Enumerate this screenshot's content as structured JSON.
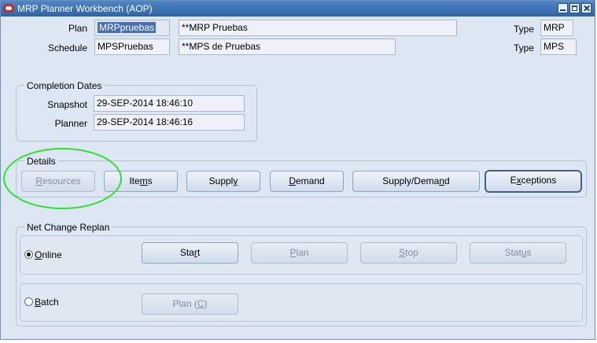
{
  "window": {
    "title": "MRP Planner Workbench (AOP)"
  },
  "header": {
    "plan_label": "Plan",
    "plan_value": "MRPpruebas",
    "plan_desc": "**MRP Pruebas",
    "plan_type_label": "Type",
    "plan_type_value": "MRP",
    "schedule_label": "Schedule",
    "schedule_value": "MPSPruebas",
    "schedule_desc": "**MPS de Pruebas",
    "schedule_type_label": "Type",
    "schedule_type_value": "MPS"
  },
  "completion": {
    "title": "Completion Dates",
    "snapshot_label": "Snapshot",
    "snapshot_value": "29-SEP-2014 18:46:10",
    "planner_label": "Planner",
    "planner_value": "29-SEP-2014 18:46:16"
  },
  "details": {
    "title": "Details",
    "resources": {
      "pre": "",
      "ul": "R",
      "post": "esources"
    },
    "items": {
      "pre": "Ite",
      "ul": "m",
      "post": "s"
    },
    "supply": {
      "pre": "Suppl",
      "ul": "y",
      "post": ""
    },
    "demand": {
      "pre": "",
      "ul": "D",
      "post": "emand"
    },
    "supply_demand": {
      "pre": "Supply/Dema",
      "ul": "n",
      "post": "d"
    },
    "exceptions": {
      "pre": "E",
      "ul": "x",
      "post": "ceptions"
    }
  },
  "replan": {
    "title": "Net Change Replan",
    "online": {
      "pre": "",
      "ul": "O",
      "post": "nline",
      "selected": true
    },
    "start": {
      "pre": "Sta",
      "ul": "r",
      "post": "t"
    },
    "plan": {
      "pre": "",
      "ul": "P",
      "post": "lan"
    },
    "stop": {
      "pre": "",
      "ul": "S",
      "post": "top"
    },
    "status": {
      "pre": "Stat",
      "ul": "u",
      "post": "s"
    },
    "batch": {
      "pre": "",
      "ul": "B",
      "post": "atch",
      "selected": false
    },
    "plan_c": {
      "pre": "Plan (",
      "ul": "C",
      "post": ")"
    }
  },
  "colors": {
    "accent": "#2f63a4",
    "annotation": "#2ee02e",
    "panel": "#dde6f3"
  }
}
